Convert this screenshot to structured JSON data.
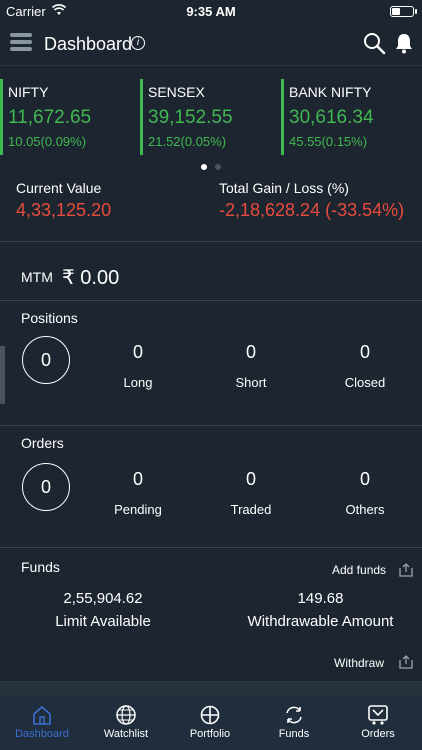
{
  "status": {
    "carrier": "Carrier",
    "time": "9:35 AM"
  },
  "header": {
    "title": "Dashboard"
  },
  "indices": [
    {
      "name": "NIFTY",
      "value": "11,672.65",
      "change": "10.05(0.09%)"
    },
    {
      "name": "SENSEX",
      "value": "39,152.55",
      "change": "21.52(0.05%)"
    },
    {
      "name": "BANK NIFTY",
      "value": "30,616.34",
      "change": "45.55(0.15%)"
    }
  ],
  "summary": {
    "current_value_label": "Current Value",
    "current_value": "4,33,125.20",
    "gain_loss_label": "Total Gain / Loss (%)",
    "gain_loss": "-2,18,628.24 (-33.54%)"
  },
  "mtm": {
    "label": "MTM",
    "value": "₹ 0.00"
  },
  "positions": {
    "title": "Positions",
    "total": "0",
    "stats": [
      {
        "label": "Long",
        "value": "0"
      },
      {
        "label": "Short",
        "value": "0"
      },
      {
        "label": "Closed",
        "value": "0"
      }
    ]
  },
  "orders": {
    "title": "Orders",
    "total": "0",
    "stats": [
      {
        "label": "Pending",
        "value": "0"
      },
      {
        "label": "Traded",
        "value": "0"
      },
      {
        "label": "Others",
        "value": "0"
      }
    ]
  },
  "funds": {
    "title": "Funds",
    "add_funds": "Add funds",
    "limit_available_value": "2,55,904.62",
    "limit_available_label": "Limit Available",
    "withdrawable_value": "149.68",
    "withdrawable_label": "Withdrawable Amount",
    "withdraw": "Withdraw"
  },
  "tabs": [
    {
      "label": "Dashboard",
      "icon": "home-icon"
    },
    {
      "label": "Watchlist",
      "icon": "globe-icon"
    },
    {
      "label": "Portfolio",
      "icon": "portfolio-icon"
    },
    {
      "label": "Funds",
      "icon": "transfer-icon"
    },
    {
      "label": "Orders",
      "icon": "cart-icon"
    }
  ],
  "colors": {
    "background": "#1c2530",
    "positive": "#3fb950",
    "negative": "#e74c3c",
    "active_tab": "#3b6fd1"
  }
}
